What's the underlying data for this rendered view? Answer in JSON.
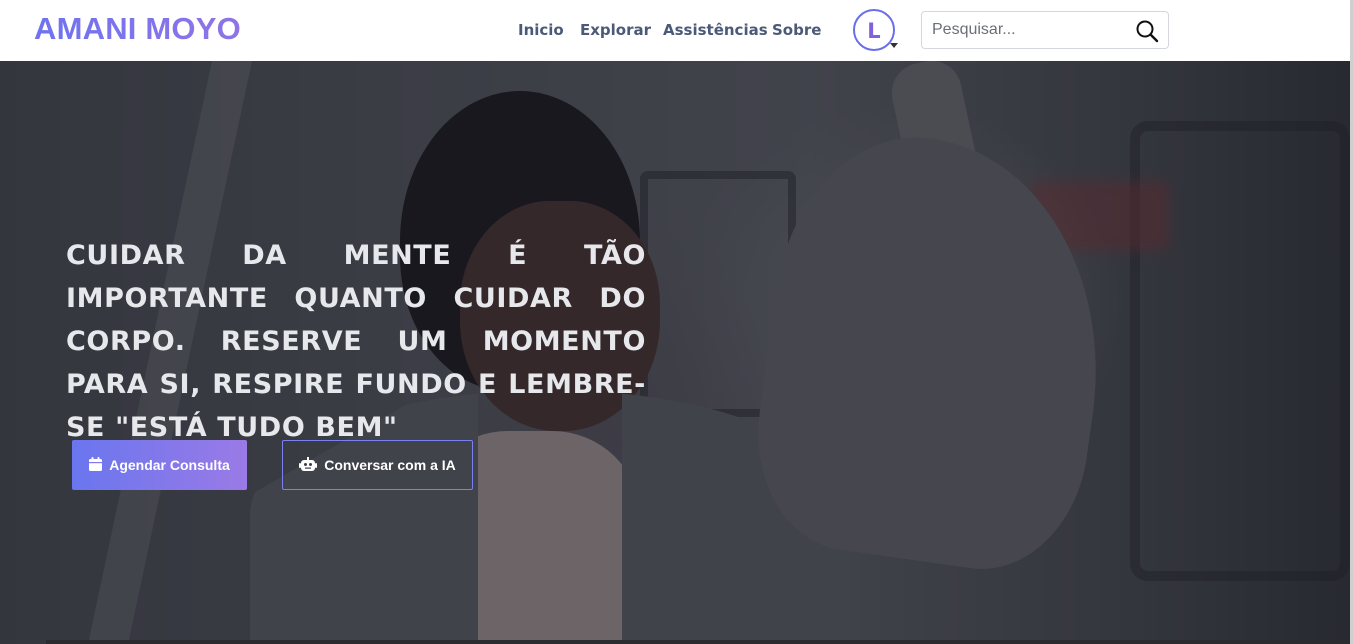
{
  "brand": {
    "name": "AMANI MOYO"
  },
  "nav": {
    "items": [
      {
        "label": "Inicio",
        "name": "nav-link-inicio"
      },
      {
        "label": "Explorar",
        "name": "nav-link-explorar"
      },
      {
        "label": "Assistências",
        "name": "nav-link-assistencias"
      },
      {
        "label": "Sobre",
        "name": "nav-link-sobre"
      }
    ]
  },
  "user": {
    "avatar_initial": "L"
  },
  "search": {
    "placeholder": "Pesquisar...",
    "icon": "search-icon"
  },
  "hero": {
    "headline": "CUIDAR DA MENTE É TÃO IMPORTANTE QUANTO CUIDAR DO CORPO. RESERVE UM MOMENTO PARA SI, RESPIRE FUNDO E LEMBRE-SE \"ESTÁ TUDO BEM\"",
    "primary_button": {
      "label": "Agendar Consulta",
      "icon": "calendar-icon"
    },
    "secondary_button": {
      "label": "Conversar com a IA",
      "icon": "robot-icon"
    }
  },
  "colors": {
    "brand_start": "#6f73f0",
    "brand_end": "#8f74e6",
    "nav_text": "#4b5a78",
    "button_gradient_start": "#6a76ee",
    "button_gradient_end": "#9a7ae6"
  }
}
